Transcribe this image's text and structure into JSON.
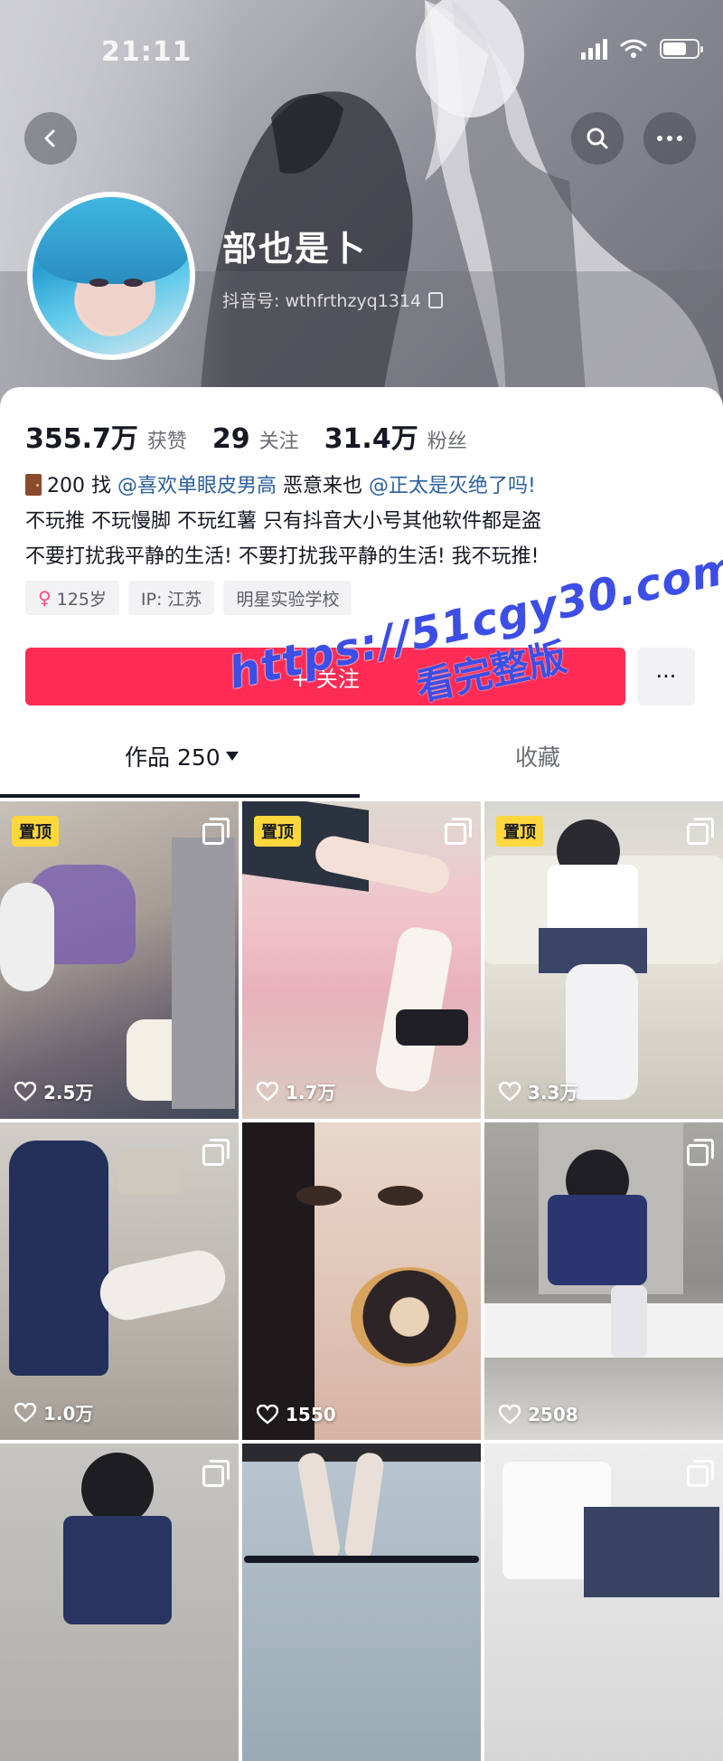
{
  "status": {
    "time": "21:11"
  },
  "profile": {
    "nickname": "部也是卜",
    "douyin_id": "抖音号: wthfrthzyq1314"
  },
  "stats": [
    {
      "value": "355.7万",
      "label": "获赞"
    },
    {
      "value": "29",
      "label": "关注"
    },
    {
      "value": "31.4万",
      "label": "粉丝"
    }
  ],
  "bio": {
    "line1_prefix": "200 找",
    "mention1": "@喜欢单眼皮男高",
    "line1_mid": "恶意来也",
    "mention2": "@正太是灭绝了吗!",
    "line2": "不玩推 不玩慢脚 不玩红薯 只有抖音大小号其他软件都是盗",
    "line3": "不要打扰我平静的生活! 不要打扰我平静的生活! 我不玩推!"
  },
  "tags": [
    "125岁",
    "IP: 江苏",
    "明星实验学校"
  ],
  "follow_button": "+ 关注",
  "follow_more": "···",
  "tabs": {
    "works": "作品 250",
    "favorites": "收藏"
  },
  "watermark": {
    "line1": "https://51cgy30.com",
    "line2": "看完整版"
  },
  "pinned_label": "置顶",
  "videos": [
    {
      "likes": "2.5万",
      "pinned": true
    },
    {
      "likes": "1.7万",
      "pinned": true
    },
    {
      "likes": "3.3万",
      "pinned": true
    },
    {
      "likes": "1.0万",
      "pinned": false
    },
    {
      "likes": "1550",
      "pinned": false
    },
    {
      "likes": "2508",
      "pinned": false
    },
    {
      "likes": "",
      "pinned": false
    },
    {
      "likes": "",
      "pinned": false
    },
    {
      "likes": "",
      "pinned": false
    }
  ],
  "colors": {
    "accent": "#fe2c55",
    "mention": "#2b5f9c",
    "pin": "#fdd73c"
  }
}
